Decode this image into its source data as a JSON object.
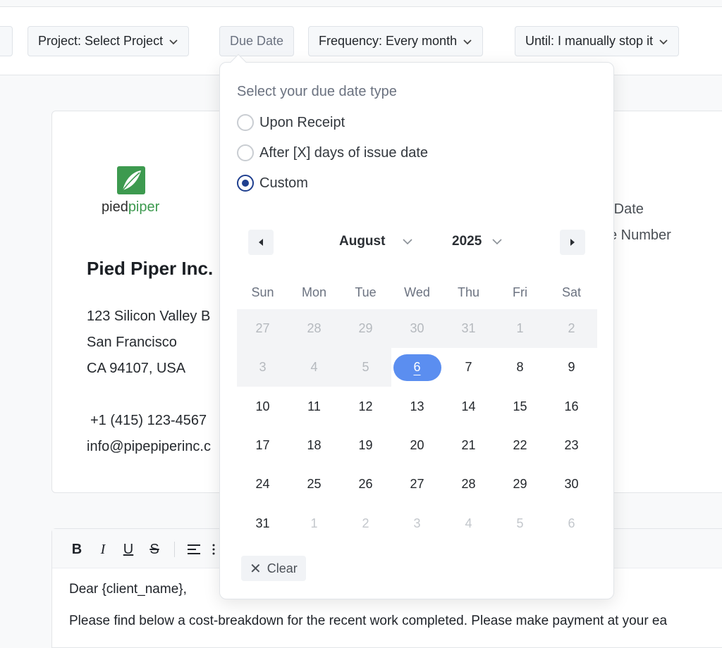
{
  "toolbar": {
    "project_label": "Project: Select Project",
    "due_date_label": "Due Date",
    "frequency_label": "Frequency: Every month",
    "until_label": "Until: I manually stop it"
  },
  "invoice": {
    "logo_text_part1": "pied",
    "logo_text_part2": "piper",
    "company_name": "Pied Piper Inc.",
    "address_line1": "123 Silicon Valley B",
    "address_line2": "San Francisco",
    "address_line3": "CA 94107, USA",
    "phone": "+1 (415) 123-4567",
    "email": "info@pipepiperinc.c",
    "meta_due_date": "e Date",
    "meta_invoice_number": "ce Number",
    "brand_color": "#3d9a4f"
  },
  "editor": {
    "line1": "Dear {client_name},",
    "line2": "Please find below a cost-breakdown for the recent work completed. Please make payment at your ea"
  },
  "popover": {
    "title": "Select your due date type",
    "options": [
      "Upon Receipt",
      "After [X] days of issue date",
      "Custom"
    ],
    "selected_option": "Custom",
    "month": "August",
    "year": "2025",
    "weekdays": [
      "Sun",
      "Mon",
      "Tue",
      "Wed",
      "Thu",
      "Fri",
      "Sat"
    ],
    "weeks": [
      [
        "27",
        "28",
        "29",
        "30",
        "31",
        "1",
        "2"
      ],
      [
        "3",
        "4",
        "5",
        "6",
        "7",
        "8",
        "9"
      ],
      [
        "10",
        "11",
        "12",
        "13",
        "14",
        "15",
        "16"
      ],
      [
        "17",
        "18",
        "19",
        "20",
        "21",
        "22",
        "23"
      ],
      [
        "24",
        "25",
        "26",
        "27",
        "28",
        "29",
        "30"
      ],
      [
        "31",
        "1",
        "2",
        "3",
        "4",
        "5",
        "6"
      ]
    ],
    "selected_day": "6",
    "clear_label": "Clear",
    "selected_color": "#5b8ef0"
  }
}
